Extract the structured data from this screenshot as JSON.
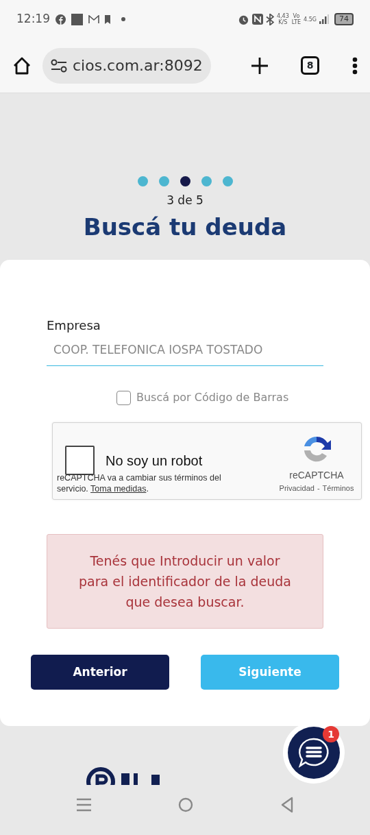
{
  "status_bar": {
    "time": "12:19",
    "net_speed": "4,43",
    "net_unit": "K/S",
    "volte_top": "Vo",
    "volte_bottom": "LTE",
    "network": "4.5G",
    "battery": "74"
  },
  "browser": {
    "url": "cios.com.ar:8092",
    "tab_count": "8"
  },
  "steps": [
    {
      "selected": false
    },
    {
      "selected": false
    },
    {
      "selected": true
    },
    {
      "selected": false
    },
    {
      "selected": false
    }
  ],
  "step_label": "3 de 5",
  "title": "Buscá tu deuda",
  "form": {
    "label": "Empresa",
    "value": "COOP. TELEFONICA IOSPA TOSTADO",
    "barcode_option": {
      "label": "Buscá por Código de Barras",
      "checked": false
    },
    "captcha": {
      "label": "No soy un robot",
      "checked": false,
      "notice": "reCAPTCHA va a cambiar sus términos del servicio.",
      "notice_link": "Toma medidas",
      "notice_end": ".",
      "brand": "reCAPTCHA",
      "privacy": "Privacidad",
      "separator": "-",
      "terms": "Términos"
    },
    "error": "Tenés que Introducir un valor para el identificador de la deuda que desea buscar.",
    "buttons": [
      {
        "label": "Anterior",
        "kind": "secondary"
      },
      {
        "label": "Siguiente",
        "kind": "primary"
      }
    ]
  },
  "chat": {
    "badge": "1"
  }
}
